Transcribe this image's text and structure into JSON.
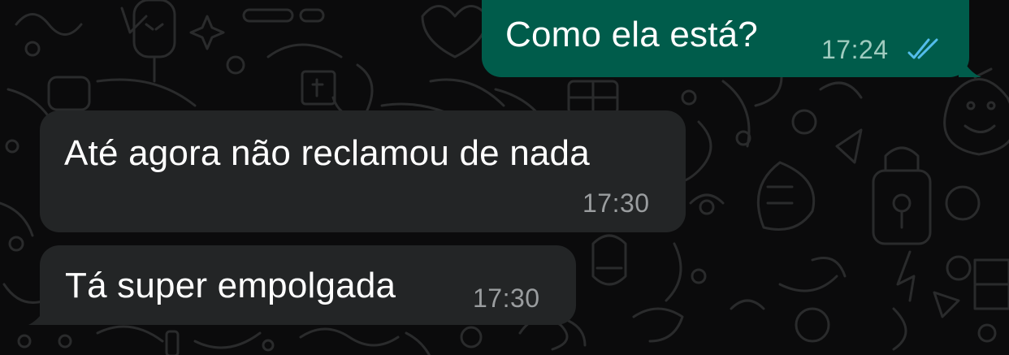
{
  "colors": {
    "background": "#0b0b0c",
    "outgoing_bubble": "#005c4b",
    "incoming_bubble": "#232526",
    "read_check": "#53bdeb",
    "timestamp_in": "#9a9d9f",
    "timestamp_out": "#9fcbbf",
    "text": "#ffffff"
  },
  "messages": [
    {
      "direction": "outgoing",
      "text": "Como ela está?",
      "time": "17:24",
      "status_icon": "double-check-read-icon"
    },
    {
      "direction": "incoming",
      "text": "Até agora não reclamou de nada",
      "time": "17:30"
    },
    {
      "direction": "incoming",
      "text": "Tá super empolgada",
      "time": "17:30"
    }
  ]
}
